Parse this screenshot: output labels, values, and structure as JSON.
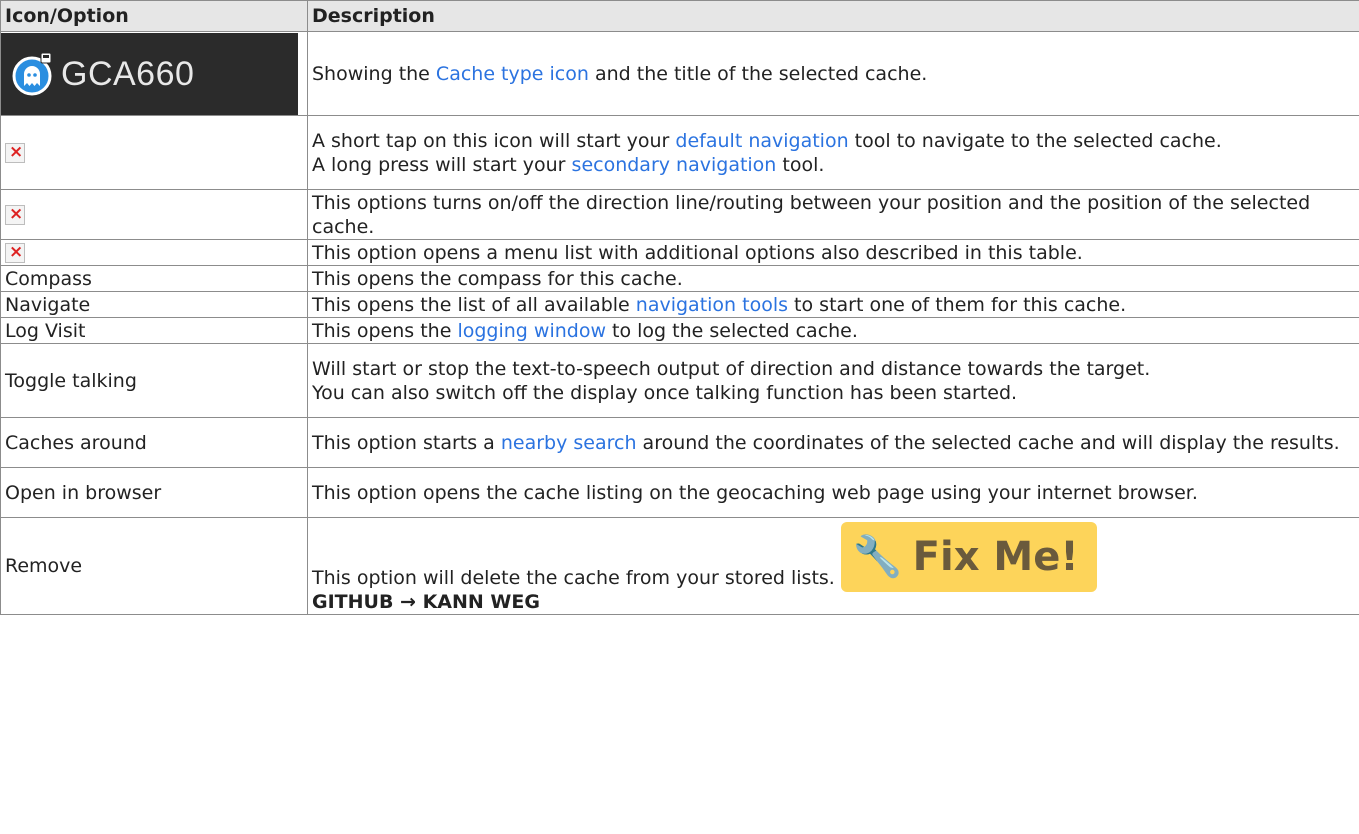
{
  "header": {
    "col1": "Icon/Option",
    "col2": "Description"
  },
  "gca_title": "GCA660",
  "rows": {
    "r1": {
      "pre": "Showing the ",
      "link": "Cache type icon",
      "post": " and the title of the selected cache."
    },
    "r2": {
      "line1_pre": "A short tap on this icon will start your ",
      "line1_link": "default navigation",
      "line1_post": " tool to navigate to the selected cache.",
      "line2_pre": "A long press will start your ",
      "line2_link": "secondary navigation",
      "line2_post": " tool."
    },
    "r3": {
      "text": "This options turns on/off the direction line/routing between your position and the position of the selected cache."
    },
    "r4": {
      "text": "This option opens a menu list with additional options also described in this table."
    },
    "r5": {
      "label": "Compass",
      "text": "This opens the compass for this cache."
    },
    "r6": {
      "label": "Navigate",
      "pre": "This opens the list of all available ",
      "link": "navigation tools",
      "post": " to start one of them for this cache."
    },
    "r7": {
      "label": "Log Visit",
      "pre": "This opens the ",
      "link": "logging window",
      "post": " to log the selected cache."
    },
    "r8": {
      "label": "Toggle talking",
      "line1": "Will start or stop the text-to-speech output of direction and distance towards the target.",
      "line2": "You can also switch off the display once talking function has been started."
    },
    "r9": {
      "label": "Caches around",
      "pre": "This option starts a ",
      "link": "nearby search",
      "post": " around the coordinates of the selected cache and will display the results."
    },
    "r10": {
      "label": "Open in browser",
      "text": "This option opens the cache listing on the geocaching web page using your internet browser."
    },
    "r11": {
      "label": "Remove",
      "text": "This option will delete the cache from your stored lists.",
      "fixme": "Fix Me!",
      "note": "GITHUB → KANN WEG"
    }
  },
  "colors": {
    "link": "#2b73e0",
    "fixme_bg": "#fdd45a",
    "header_bg": "#e6e6e6",
    "icon_box_bg": "#2b2b2b"
  }
}
